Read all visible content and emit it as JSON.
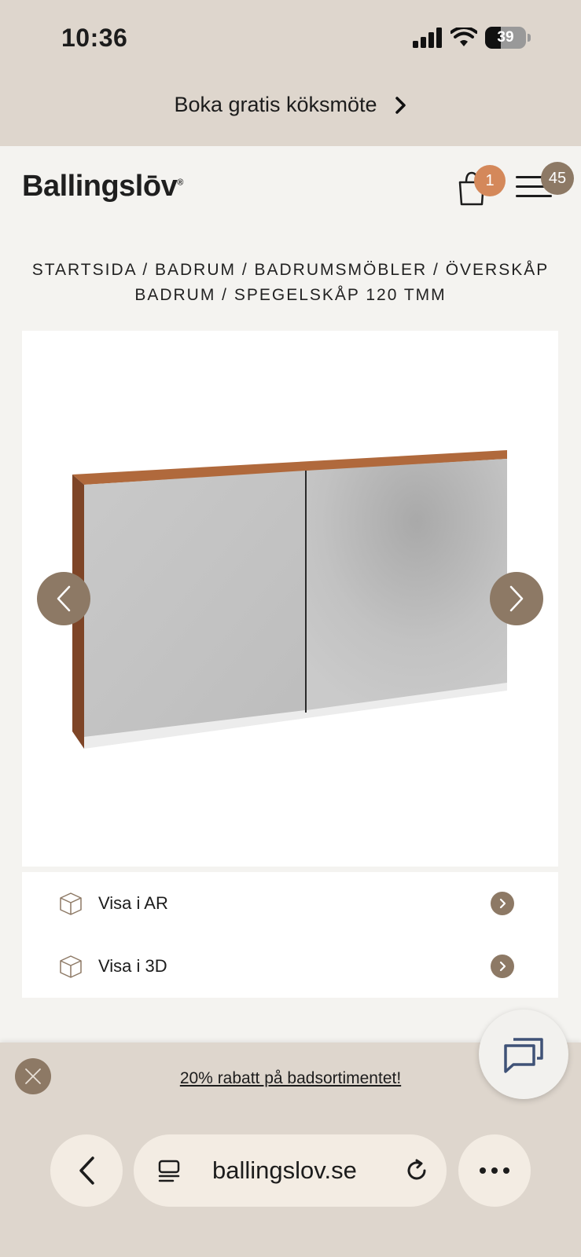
{
  "status_bar": {
    "time": "10:36",
    "battery": "39"
  },
  "promo_banner": {
    "text": "Boka gratis köksmöte"
  },
  "header": {
    "logo": "Ballingslōv",
    "cart_count": "1",
    "menu_badge": "45"
  },
  "breadcrumb": {
    "text": "STARTSIDA / BADRUM / BADRUMSMÖBLER / ÖVERSKÅP BADRUM / SPEGELSKÅP 120 TMM"
  },
  "view_options": [
    {
      "label": "Visa i AR"
    },
    {
      "label": "Visa i 3D"
    }
  ],
  "bottom_promo": {
    "text": "20% rabatt på badsortimentet!"
  },
  "browser": {
    "url": "ballingslov.se"
  },
  "colors": {
    "accent": "#8d7965",
    "cart_badge": "#d4885a",
    "top_bg": "#ded6cd"
  }
}
